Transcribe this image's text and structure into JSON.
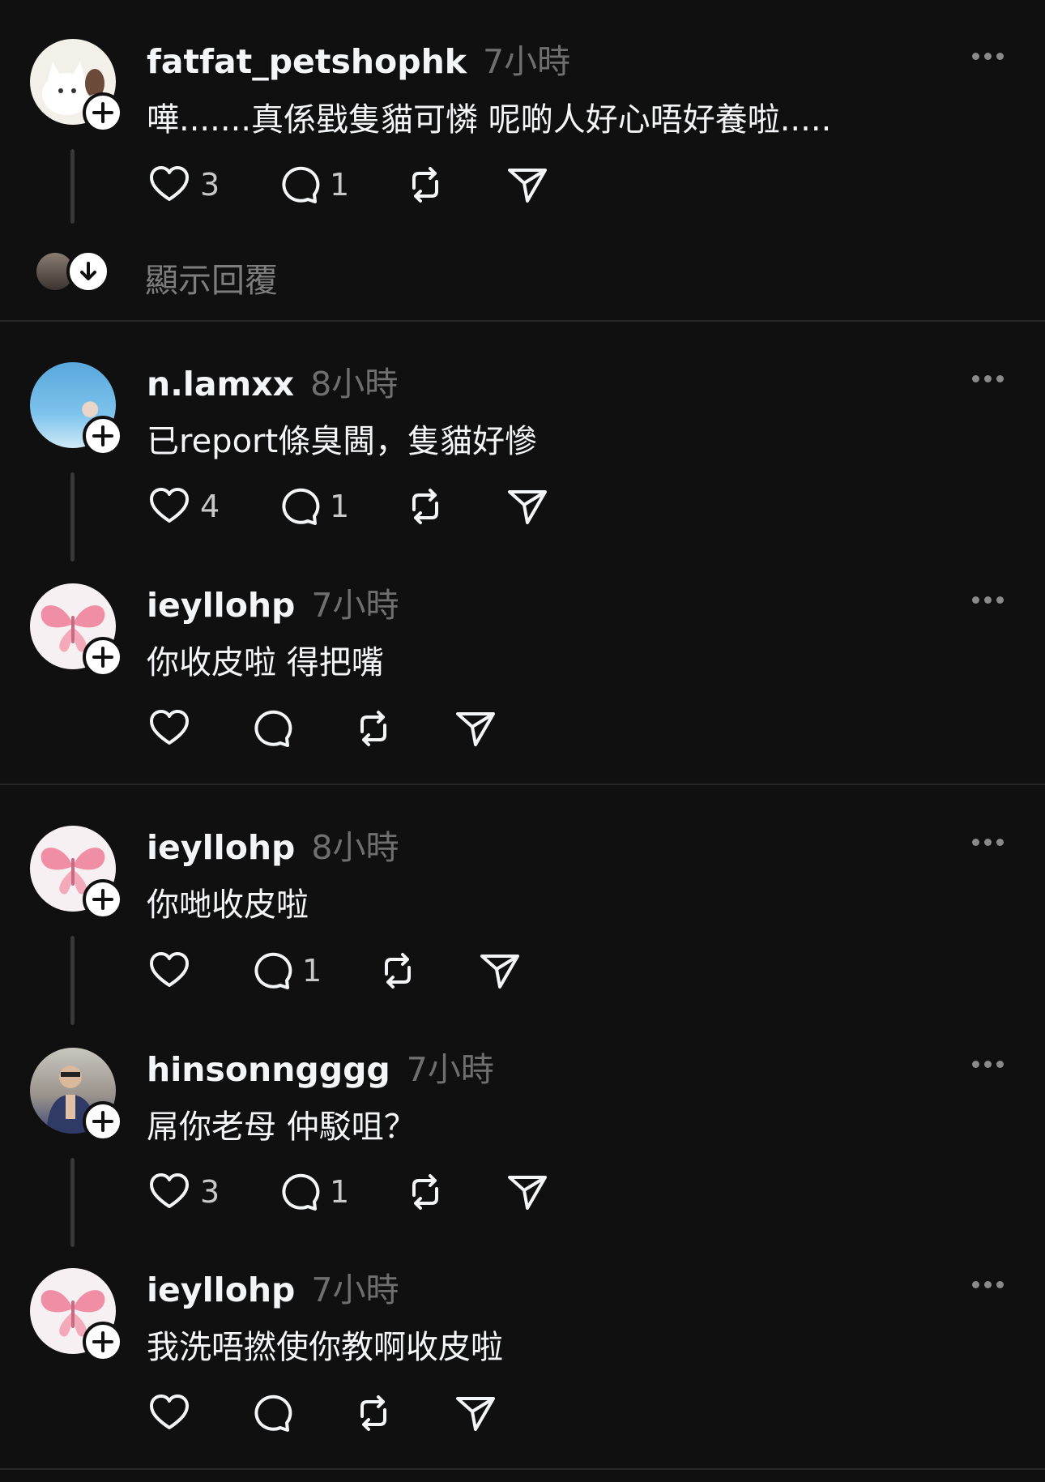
{
  "posts": [
    {
      "username": "fatfat_petshophk",
      "time": "7小時",
      "text": "嘩.......真係戥隻貓可憐 呢啲人好心唔好養啦.....",
      "likes": "3",
      "replies": "1"
    },
    {
      "username": "n.lamxx",
      "time": "8小時",
      "text": "已report條臭閪，隻貓好慘",
      "likes": "4",
      "replies": "1"
    },
    {
      "username": "ieyllohp",
      "time": "7小時",
      "text": "你收皮啦 得把嘴",
      "likes": "",
      "replies": ""
    },
    {
      "username": "ieyllohp",
      "time": "8小時",
      "text": "你哋收皮啦",
      "likes": "",
      "replies": "1"
    },
    {
      "username": "hinsonngggg",
      "time": "7小時",
      "text": "屌你老母 仲駁咀？",
      "likes": "3",
      "replies": "1"
    },
    {
      "username": "ieyllohp",
      "time": "7小時",
      "text": "我洗唔撚使你教啊收皮啦",
      "likes": "",
      "replies": ""
    }
  ],
  "show_replies_label": "顯示回覆",
  "icons": [
    "heart-icon",
    "comment-icon",
    "repost-icon",
    "share-icon",
    "more-icon",
    "follow-plus-icon",
    "arrow-down-icon"
  ],
  "colors": {
    "background": "#101010",
    "text": "#f3f5f7",
    "muted": "#6f6f6f"
  }
}
